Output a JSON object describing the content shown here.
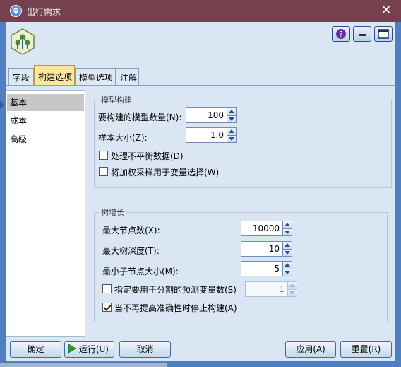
{
  "window": {
    "title": "出行需求",
    "close_symbol": "✕"
  },
  "tabs": [
    {
      "label": "字段"
    },
    {
      "label": "构建选项"
    },
    {
      "label": "模型选项"
    },
    {
      "label": "注解"
    }
  ],
  "nav": {
    "items": [
      {
        "label": "基本"
      },
      {
        "label": "成本"
      },
      {
        "label": "高级"
      }
    ],
    "selected": "基本"
  },
  "model_build": {
    "legend": "模型构建",
    "num_models_label": "要构建的模型数量(N):",
    "num_models_value": "100",
    "sample_size_label": "样本大小(Z):",
    "sample_size_value": "1.0",
    "imbalanced_label": "处理不平衡数据(D)",
    "imbalanced_checked": false,
    "weighted_label": "将加权采样用于变量选择(W)",
    "weighted_checked": false
  },
  "tree_growth": {
    "legend": "树增长",
    "max_nodes_label": "最大节点数(X):",
    "max_nodes_value": "10000",
    "max_depth_label": "最大树深度(T):",
    "max_depth_value": "10",
    "min_child_label": "最小子节点大小(M):",
    "min_child_value": "5",
    "num_predictors_label": "指定要用于分割的预测变量数(S)",
    "num_predictors_checked": false,
    "num_predictors_value": "1",
    "stop_label": "当不再提高准确性时停止构建(A)",
    "stop_checked": true
  },
  "buttons": {
    "ok": "确定",
    "run": "运行(U)",
    "cancel": "取消",
    "apply": "应用(A)",
    "reset": "重置(R)"
  },
  "colors": {
    "titlebar": "#76414f",
    "active_tab": "#fbe7a0",
    "client": "#dbe6f4",
    "accent": "#4e7ec3"
  }
}
